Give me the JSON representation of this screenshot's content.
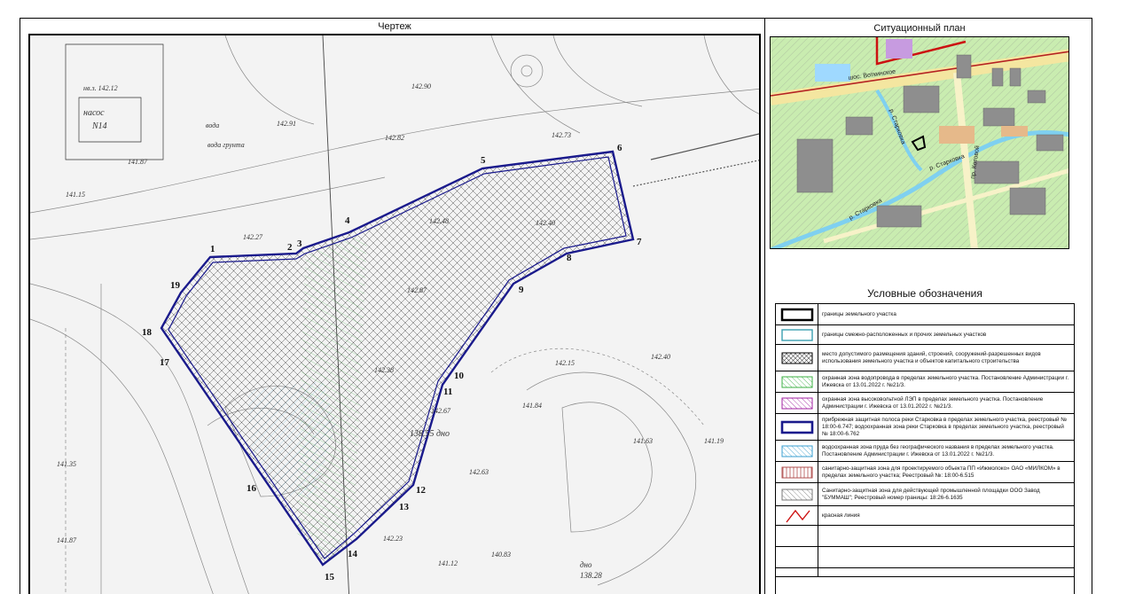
{
  "drawing": {
    "title": "Чертеж",
    "boundary_point_labels": [
      "1",
      "2",
      "3",
      "4",
      "5",
      "6",
      "7",
      "8",
      "9",
      "10",
      "11",
      "12",
      "13",
      "14",
      "15",
      "16",
      "17",
      "18",
      "19"
    ],
    "survey_texts": [
      "насос",
      "N14",
      "нв.з. 142.12",
      "142.90",
      "142.91",
      "вода",
      "вода грунта",
      "138.55 дно",
      "138.28",
      "дно",
      "142.87",
      "142.23",
      "142.15",
      "141.84",
      "142.40",
      "141.63",
      "141.19",
      "141.15",
      "142.67",
      "142.38",
      "141.12",
      "140.83",
      "141.87",
      "141.35",
      "142.63",
      "142.27",
      "141.87",
      "142.73",
      "142.82",
      "142.48",
      "142.40"
    ]
  },
  "situational_plan": {
    "title": "Ситуационный план",
    "street_labels": [
      "шос. Воткинское",
      "р. Старковка",
      "р. Старковка",
      "пр. Котовой",
      "р. Старковка"
    ]
  },
  "legend": {
    "title": "Условные обозначения",
    "items": [
      {
        "symbol": "land-plot-boundary-icon",
        "text": "границы земельного участка"
      },
      {
        "symbol": "adjacent-boundary-icon",
        "text": "границы смежно-расположенных и прочих земельных участков"
      },
      {
        "symbol": "crosshatch-icon",
        "text": "место допустимого размещения зданий, строений, сооружений-разрешенных видов использования земельного участка и объектов капитального строительства"
      },
      {
        "symbol": "green-hatch-icon",
        "text": "охранная зона водопровода в пределах земельного участка. Постановление Администрации г. Ижевска от 13.01.2022 г. №21/3."
      },
      {
        "symbol": "purple-hatch-icon",
        "text": "охранная зона высоковольтной ЛЭП в пределах земельного участка. Постановление Администрации г. Ижевска от 13.01.2022 г. №21/3."
      },
      {
        "symbol": "navy-boundary-icon",
        "text": "прибрежная защитная полоса реки Старковка в пределах земельного участка, реестровый № 18:00-6.747; водоохранная зона реки Старковка в пределах земельного участка, реестровый № 18:00-6.762"
      },
      {
        "symbol": "cyan-hatch-icon",
        "text": "водоохранная зона пруда без географического названия в пределах земельного участка. Постановление Администрации г. Ижевска от 13.01.2022 г. №21/3."
      },
      {
        "symbol": "vertical-hatch-icon",
        "text": "санитарно-защитная зона для проектируемого объекта ПП «Ижмолоко» ОАО «МИЛКОМ» в пределах земельного участка; Реестровый №: 18:00-6.515"
      },
      {
        "symbol": "gray-hatch-icon",
        "text": "Санитарно-защитная зона для действующей промышленной площадки ООО Завод \"БУММАШ\"; Реестровый номер границы: 18:26-6.1635"
      },
      {
        "symbol": "red-line-icon",
        "text": "красная линия"
      },
      {
        "symbol": "",
        "text": ""
      },
      {
        "symbol": "",
        "text": ""
      },
      {
        "symbol": "",
        "text": ""
      }
    ]
  },
  "colors": {
    "boundary": "#1a1a8c",
    "crosshatch": "#555555",
    "green_hatch": "#3cb043",
    "purple_hatch": "#a020a0",
    "cyan_hatch": "#3a9fd0",
    "red_line": "#cc1111",
    "river": "#8fd3f0",
    "land": "#bfe8a8"
  }
}
